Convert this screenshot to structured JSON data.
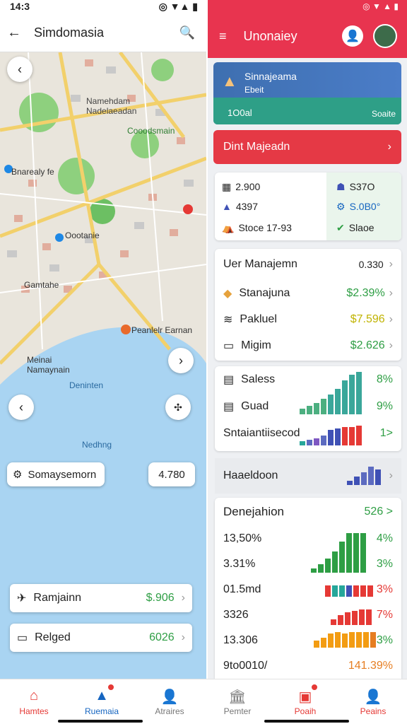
{
  "left": {
    "status": {
      "time": "14:3",
      "signal": "📶"
    },
    "appbar": {
      "title": "Simdomasia",
      "back": "←",
      "search": "🔍"
    },
    "map": {
      "labels": [
        {
          "text": "Namehdam\nNadelaeadan"
        },
        {
          "text": "Cooodsmain"
        },
        {
          "text": "Bnarealy fe"
        },
        {
          "text": "Oootanie"
        },
        {
          "text": "Gamtahe"
        },
        {
          "text": "Peanlelr Earnan"
        },
        {
          "text": "Meinai\nNamaynain"
        },
        {
          "text": "Deninten"
        },
        {
          "text": "Nedhng"
        }
      ],
      "search_label": "Somaysemorn",
      "value_chip": "4.780"
    },
    "cards": [
      {
        "label": "Ramjainn",
        "value": "$.906",
        "icon": "pin-icon"
      },
      {
        "label": "Relged",
        "value": "6026",
        "icon": "folder-icon"
      }
    ]
  },
  "right": {
    "appbar": {
      "title": "Unonaiey"
    },
    "banner": {
      "title": "Sinnajeama",
      "subtitle": "Ebeit",
      "left_text": "1O0al",
      "right_text": "Soaite"
    },
    "red_bar": {
      "label": "Dint Majeadn"
    },
    "stats": [
      {
        "value": "2.900",
        "icon": "building-icon"
      },
      {
        "value": "4397",
        "icon": "tent-icon"
      },
      {
        "value": "Stoce 17-93",
        "icon": "tent-icon"
      },
      {
        "value": "S37O",
        "icon": "person-icon"
      },
      {
        "value": "S.0B0°",
        "icon": "gear-icon"
      },
      {
        "value": "Slaoe",
        "icon": "thumb-icon"
      }
    ],
    "user_card": {
      "title": "Uer Manajemn",
      "title_value": "0.330",
      "rows": [
        {
          "label": "Stanajuna",
          "value": "$2.39%",
          "color": "#2e9e44"
        },
        {
          "label": "Pakluel",
          "value": "$7.596",
          "color": "#c0b300"
        },
        {
          "label": "Migim",
          "value": "$2.626",
          "color": "#2e9e44"
        }
      ]
    },
    "sales_card": {
      "rows": [
        {
          "label": "Saless",
          "value": "8%"
        },
        {
          "label": "Guad",
          "value": "9%"
        },
        {
          "label": "Sntaiantiisecod",
          "value": "1>"
        }
      ]
    },
    "mid_row": {
      "label": "Haaeldoon"
    },
    "dev_card": {
      "title": "Denejahion",
      "title_value": "526 >",
      "rows": [
        {
          "label": "13,50%",
          "value": "4%"
        },
        {
          "label": "3.31%",
          "value": "3%"
        },
        {
          "label": "01.5md",
          "value": "3%"
        },
        {
          "label": "3326",
          "value": "7%"
        },
        {
          "label": "13.306",
          "value": "3%"
        },
        {
          "label": "9to0010/",
          "value": "141.39%"
        }
      ]
    }
  },
  "nav": [
    {
      "label": "Hamtes",
      "color": "#e53935",
      "icon": "home-icon",
      "glyph": "⌂"
    },
    {
      "label": "Ruemaia",
      "color": "#1565c0",
      "icon": "map-icon",
      "glyph": "▲"
    },
    {
      "label": "Atraires",
      "color": "#777777",
      "icon": "person-icon",
      "glyph": "👤"
    },
    {
      "label": "Pemter",
      "color": "#777777",
      "icon": "building-icon",
      "glyph": "🏛"
    },
    {
      "label": "Poaih",
      "color": "#e53935",
      "icon": "briefcase-icon",
      "glyph": "▣"
    },
    {
      "label": "Peains",
      "color": "#e53935",
      "icon": "person-icon",
      "glyph": "👤"
    }
  ]
}
